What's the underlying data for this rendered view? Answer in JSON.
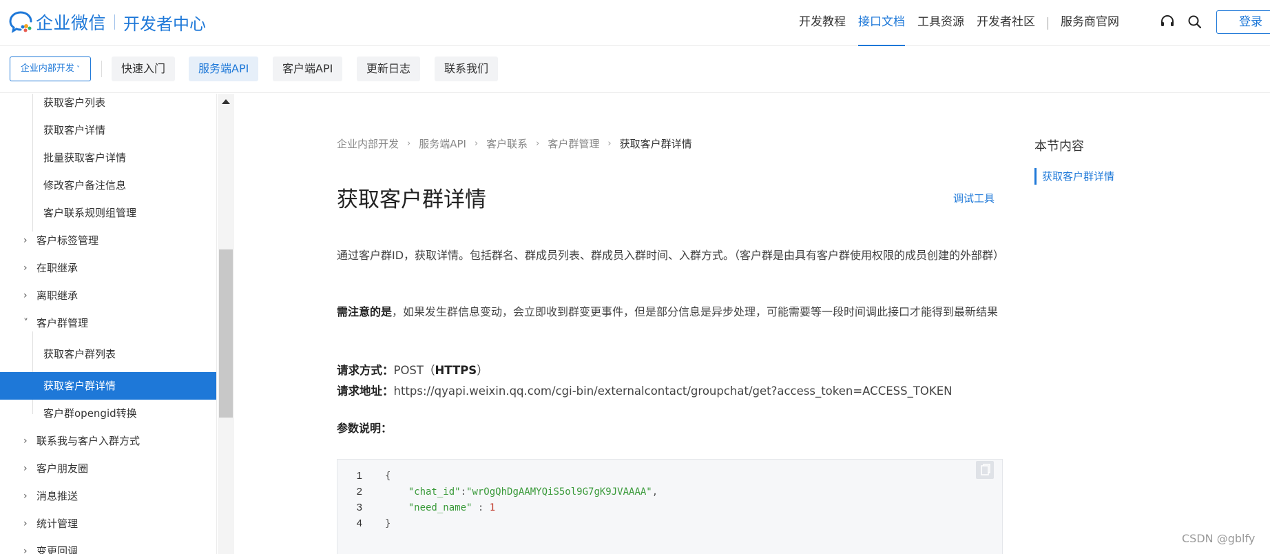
{
  "brand": {
    "name": "企业微信",
    "sub": "开发者中心",
    "color": "#1e78d8"
  },
  "topnav": {
    "items": [
      {
        "label": "开发教程",
        "active": false
      },
      {
        "label": "接口文档",
        "active": true
      },
      {
        "label": "工具资源",
        "active": false
      },
      {
        "label": "开发者社区",
        "active": false
      }
    ],
    "external": "服务商官网",
    "login_label": "登录"
  },
  "subnav": {
    "scope": "企业内部开发",
    "tabs": [
      {
        "label": "快速入门",
        "active": false
      },
      {
        "label": "服务端API",
        "active": true
      },
      {
        "label": "客户端API",
        "active": false
      },
      {
        "label": "更新日志",
        "active": false
      },
      {
        "label": "联系我们",
        "active": false
      }
    ]
  },
  "sidebar": {
    "items": [
      {
        "label": "获取客户列表",
        "level": 2
      },
      {
        "label": "获取客户详情",
        "level": 2
      },
      {
        "label": "批量获取客户详情",
        "level": 2
      },
      {
        "label": "修改客户备注信息",
        "level": 2
      },
      {
        "label": "客户联系规则组管理",
        "level": 2
      },
      {
        "label": "客户标签管理",
        "level": 1,
        "expanded": false
      },
      {
        "label": "在职继承",
        "level": 1,
        "expanded": false
      },
      {
        "label": "离职继承",
        "level": 1,
        "expanded": false
      },
      {
        "label": "客户群管理",
        "level": 1,
        "expanded": true
      },
      {
        "label": "获取客户群列表",
        "level": 2
      },
      {
        "label": "获取客户群详情",
        "level": 2,
        "active": true
      },
      {
        "label": "客户群opengid转换",
        "level": 2
      },
      {
        "label": "联系我与客户入群方式",
        "level": 1,
        "expanded": false
      },
      {
        "label": "客户朋友圈",
        "level": 1,
        "expanded": false
      },
      {
        "label": "消息推送",
        "level": 1,
        "expanded": false
      },
      {
        "label": "统计管理",
        "level": 1,
        "expanded": false
      },
      {
        "label": "变更回调",
        "level": 1,
        "expanded": false
      }
    ]
  },
  "main": {
    "breadcrumb": [
      "企业内部开发",
      "服务端API",
      "客户联系",
      "客户群管理",
      "获取客户群详情"
    ],
    "title": "获取客户群详情",
    "debug_link": "调试工具",
    "intro": "通过客户群ID，获取详情。包括群名、群成员列表、群成员入群时间、入群方式。（客户群是由具有客户群使用权限的成员创建的外部群）",
    "note_label": "需注意的是",
    "note_text": "，如果发生群信息变动，会立即收到群变更事件，但是部分信息是异步处理，可能需要等一段时间调此接口才能得到最新结果",
    "method_label": "请求方式：",
    "method_value": "POST（",
    "method_proto": "HTTPS",
    "method_close": "）",
    "url_label": "请求地址：",
    "url_value": "https://qyapi.weixin.qq.com/cgi-bin/externalcontact/groupchat/get?access_token=ACCESS_TOKEN",
    "params_title": "参数说明：",
    "code": {
      "line_numbers": [
        "1",
        "2",
        "3",
        "4"
      ],
      "open": "{",
      "key1": "\"chat_id\"",
      "colon1": ":",
      "val1": "\"wrOgQhDgAAMYQiS5ol9G7gK9JVAAAA\"",
      "comma1": ",",
      "key2": "\"need_name\"",
      "colon2": " : ",
      "val2": "1",
      "close": "}"
    }
  },
  "toc": {
    "title": "本节内容",
    "items": [
      "获取客户群详情"
    ]
  },
  "watermark": "CSDN @gblfy"
}
